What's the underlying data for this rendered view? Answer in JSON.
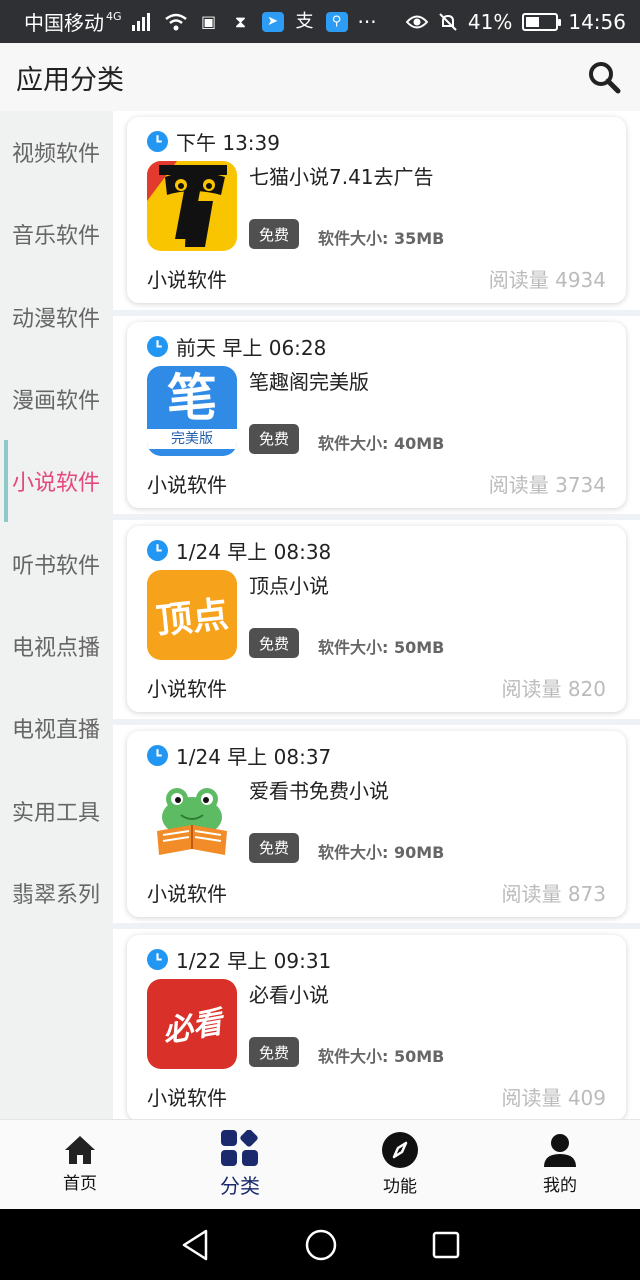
{
  "status_bar": {
    "carrier": "中国移动",
    "network": "4G",
    "battery": "41%",
    "time": "14:56",
    "more": "···"
  },
  "header": {
    "title": "应用分类",
    "search_icon": "search-icon"
  },
  "sidebar": {
    "items": [
      {
        "label": "视频软件",
        "active": false
      },
      {
        "label": "音乐软件",
        "active": false
      },
      {
        "label": "动漫软件",
        "active": false
      },
      {
        "label": "漫画软件",
        "active": false
      },
      {
        "label": "小说软件",
        "active": true
      },
      {
        "label": "听书软件",
        "active": false
      },
      {
        "label": "电视点播",
        "active": false
      },
      {
        "label": "电视直播",
        "active": false
      },
      {
        "label": "实用工具",
        "active": false
      },
      {
        "label": "翡翠系列",
        "active": false
      }
    ]
  },
  "cards": [
    {
      "time": "下午 13:39",
      "name": "七猫小说7.41去广告",
      "badge": "免费",
      "size": "软件大小: 35MB",
      "category": "小说软件",
      "reads": "阅读量 4934",
      "icon_text": "7",
      "icon_color": "#f9c400"
    },
    {
      "time": "前天 早上 06:28",
      "name": "笔趣阁完美版",
      "badge": "免费",
      "size": "软件大小: 40MB",
      "category": "小说软件",
      "reads": "阅读量 3734",
      "icon_text": "笔",
      "icon_sub": "完美版",
      "icon_color": "#2f8be6"
    },
    {
      "time": "1/24 早上 08:38",
      "name": "顶点小说",
      "badge": "免费",
      "size": "软件大小: 50MB",
      "category": "小说软件",
      "reads": "阅读量 820",
      "icon_text": "顶点",
      "icon_color": "#f7a21b"
    },
    {
      "time": "1/24 早上 08:37",
      "name": "爱看书免费小说",
      "badge": "免费",
      "size": "软件大小: 90MB",
      "category": "小说软件",
      "reads": "阅读量 873",
      "icon_color": "#5dbb63"
    },
    {
      "time": "1/22 早上 09:31",
      "name": "必看小说",
      "badge": "免费",
      "size": "软件大小: 50MB",
      "category": "小说软件",
      "reads": "阅读量 409",
      "icon_text": "必看",
      "icon_color": "#d9302a"
    }
  ],
  "tabbar": {
    "tabs": [
      {
        "label": "首页",
        "icon": "home-icon",
        "active": false
      },
      {
        "label": "分类",
        "icon": "grid-icon",
        "active": true
      },
      {
        "label": "功能",
        "icon": "compass-icon",
        "active": false
      },
      {
        "label": "我的",
        "icon": "person-icon",
        "active": false
      }
    ]
  },
  "colors": {
    "accent": "#e5497b",
    "tab_active": "#1a2a6c",
    "clock": "#2196f3"
  }
}
